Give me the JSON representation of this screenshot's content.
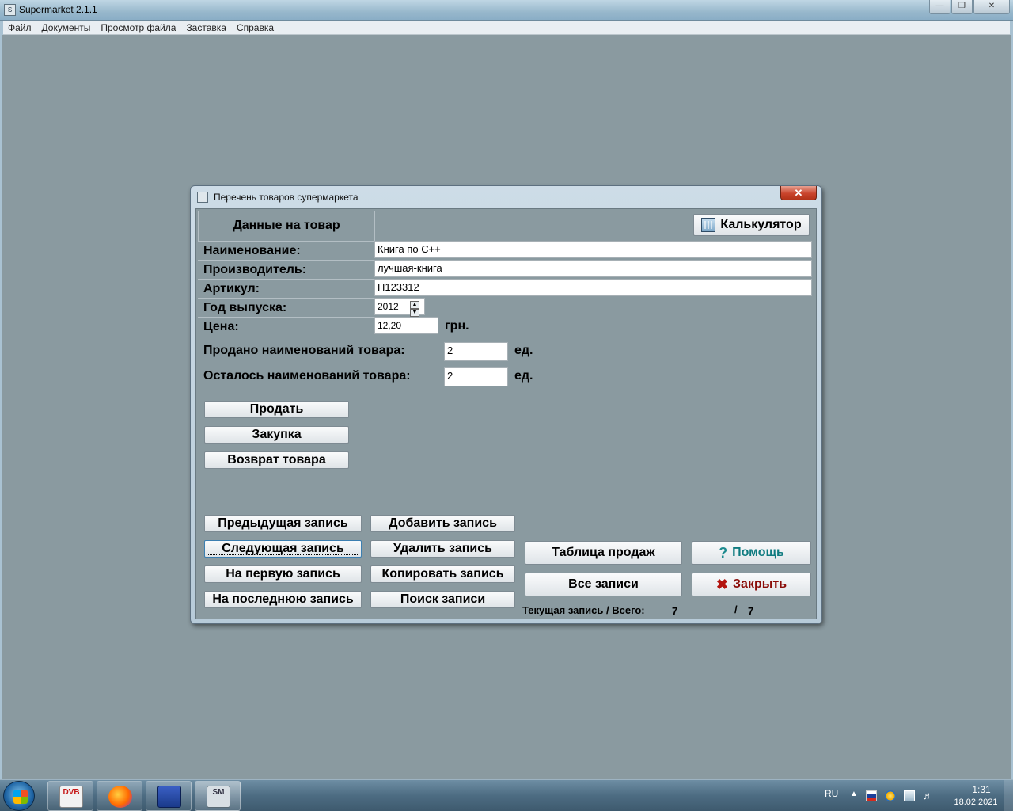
{
  "app": {
    "title": "Supermarket 2.1.1",
    "icon_text": "S"
  },
  "menu": [
    "Файл",
    "Документы",
    "Просмотр файла",
    "Заставка",
    "Справка"
  ],
  "dialog": {
    "title": "Перечень товаров супермаркета",
    "header": "Данные на товар",
    "calc_label": "Калькулятор",
    "fields": {
      "name_label": "Наименование:",
      "name_value": "Книга по C++",
      "maker_label": "Производитель:",
      "maker_value": "лучшая-книга",
      "article_label": "Артикул:",
      "article_value": "П123312",
      "year_label": "Год  выпуска:",
      "year_value": "2012",
      "price_label": "Цена:",
      "price_value": "12,20",
      "price_unit": "грн.",
      "sold_label": "Продано  наименований  товара:",
      "sold_value": "2",
      "sold_unit": "ед.",
      "left_label": "Осталось  наименований  товара:",
      "left_value": "2",
      "left_unit": "ед."
    },
    "buttons": {
      "sell": "Продать",
      "purchase": "Закупка",
      "return": "Возврат  товара",
      "prev": "Предыдущая  запись",
      "next": "Следующая  запись",
      "first": "На  первую  запись",
      "last": "На  последнюю  запись",
      "add": "Добавить  запись",
      "delete": "Удалить  запись",
      "copy": "Копировать  запись",
      "search": "Поиск  записи",
      "sales_table": "Таблица  продаж",
      "all_records": "Все  записи",
      "help": "Помощь",
      "close": "Закрыть"
    },
    "status": {
      "label": "Текущая  запись / Всего:",
      "current": "7",
      "separator": "/",
      "total": "7"
    }
  },
  "taskbar": {
    "lang": "RU",
    "time": "1:31",
    "date": "18.02.2021",
    "apps": [
      "DVB",
      "firefox",
      "save",
      "SM"
    ]
  }
}
